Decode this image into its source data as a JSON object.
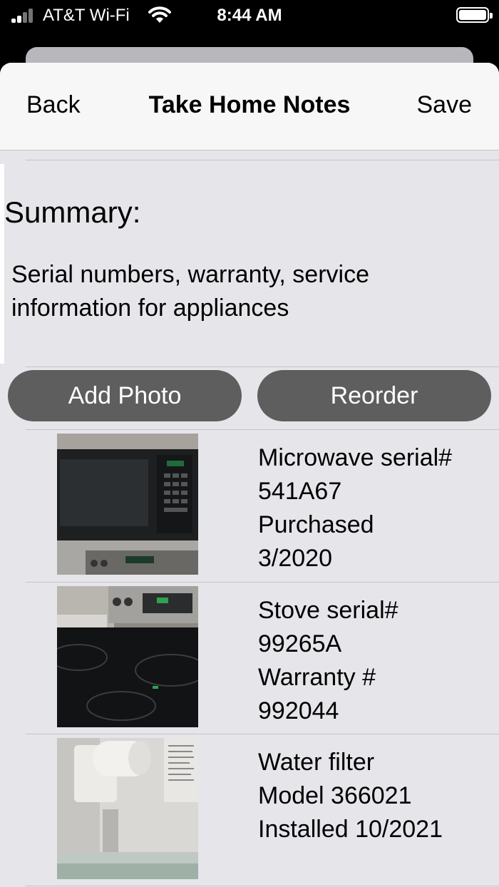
{
  "status_bar": {
    "carrier": "AT&T Wi-Fi",
    "time": "8:44 AM",
    "icons": [
      "signal-icon",
      "wifi-icon",
      "battery-icon"
    ]
  },
  "nav": {
    "back_label": "Back",
    "title": "Take Home Notes",
    "save_label": "Save"
  },
  "summary": {
    "label": "Summary:",
    "text": "Serial numbers, warranty, service information for appliances"
  },
  "actions": {
    "add_photo_label": "Add Photo",
    "reorder_label": "Reorder"
  },
  "photos": [
    {
      "line1": "Microwave serial#",
      "line2": "541A67",
      "line3": "Purchased",
      "line4": "3/2020",
      "image": "microwave-photo"
    },
    {
      "line1": "Stove serial#",
      "line2": "99265A",
      "line3": "Warranty #",
      "line4": "992044",
      "image": "stove-photo"
    },
    {
      "line1": "Water filter",
      "line2": "Model 366021",
      "line3": "Installed 10/2021",
      "image": "water-filter-photo"
    }
  ],
  "colors": {
    "background": "#e5e5ea",
    "navbar": "#f7f7f8",
    "button": "#5e5e5e",
    "separator": "#c6c6c8"
  }
}
